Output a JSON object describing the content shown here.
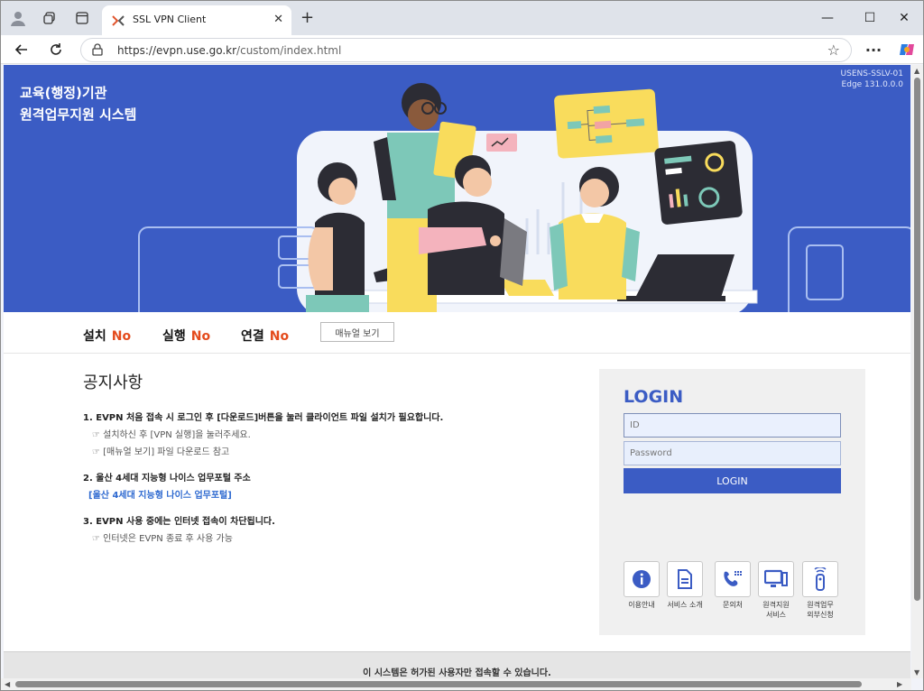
{
  "browser": {
    "tab_title": "SSL VPN Client",
    "url_host": "https://evpn.use.go.kr",
    "url_path": "/custom/index.html",
    "new_tab": "+",
    "tab_close": "✕",
    "win_min": "—",
    "win_max": "☐",
    "win_close": "✕",
    "more": "···"
  },
  "hero": {
    "org_line1": "교육(행정)기관",
    "org_line2": "원격업무지원 시스템",
    "version_line1": "USENS-SSLV-01",
    "version_line2": "Edge 131.0.0.0"
  },
  "status": {
    "install_label": "설치",
    "install_value": "No",
    "run_label": "실행",
    "run_value": "No",
    "connect_label": "연결",
    "connect_value": "No",
    "manual_button": "매뉴얼 보기"
  },
  "notice": {
    "title": "공지사항",
    "item1": "1. EVPN 처음 접속 시 로그인 후 [다운로드]버튼을 눌러 클라이언트 파일 설치가 필요합니다.",
    "item1_sub1": "☞ 설치하신 후 [VPN 실행]을 눌러주세요.",
    "item1_sub2": "☞ [매뉴얼 보기] 파일 다운로드 참고",
    "item2": "2. 울산 4세대 지능형 나이스 업무포털 주소",
    "item2_link": "[울산 4세대 지능형 나이스 업무포털]",
    "item3": "3. EVPN 사용 중에는 인터넷 접속이 차단됩니다.",
    "item3_sub1": "☞ 인터넷은 EVPN 종료 후 사용 가능"
  },
  "login": {
    "title": "LOGIN",
    "id_placeholder": "ID",
    "password_placeholder": "Password",
    "button": "LOGIN"
  },
  "quick_links": [
    {
      "label": "이용안내",
      "icon": "info-icon"
    },
    {
      "label": "서비스 소개",
      "icon": "document-icon"
    },
    {
      "label": "문의처",
      "icon": "phone-icon"
    },
    {
      "label": "원격지원\n서비스",
      "icon": "monitor-icon"
    },
    {
      "label": "원격업무\n외부신청",
      "icon": "remote-icon"
    }
  ],
  "footer": {
    "text": "이 시스템은 허가된 사용자만 접속할 수 있습니다."
  },
  "colors": {
    "brand_blue": "#3b5cc4",
    "status_no": "#e44b1c"
  }
}
